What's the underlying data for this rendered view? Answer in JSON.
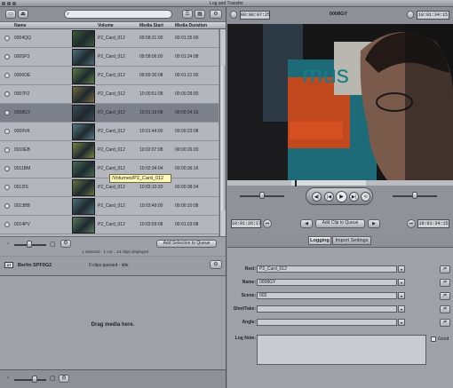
{
  "window": {
    "title": "Log and Transfer"
  },
  "browser": {
    "search_placeholder": "",
    "columns": {
      "name": "Name",
      "volume": "Volume",
      "media_start": "Media Start",
      "media_duration": "Media Duration"
    },
    "clips": [
      {
        "name": "0004QQ",
        "volume": "P2_Card_012",
        "start": "09:58:31:00",
        "duration": "00:01:35:00",
        "selected": false,
        "thumb": "#3d5a3a"
      },
      {
        "name": "0005P3",
        "volume": "P2_Card_012",
        "start": "09:58:06:00",
        "duration": "00:01:24:08",
        "selected": false,
        "thumb": "#4d6f7a"
      },
      {
        "name": "0006OE",
        "volume": "P2_Card_012",
        "start": "09:59:30:08",
        "duration": "00:01:21:00",
        "selected": false,
        "thumb": "#5e7b45"
      },
      {
        "name": "0007P2",
        "volume": "P2_Card_012",
        "start": "10:00:51:08",
        "duration": "00:00:28:00",
        "selected": false,
        "thumb": "#7a6a3e"
      },
      {
        "name": "0008GY",
        "volume": "P2_Card_012",
        "start": "10:01:19:08",
        "duration": "00:00:24:16",
        "selected": true,
        "thumb": "#3f4a55"
      },
      {
        "name": "0009VK",
        "volume": "P2_Card_012",
        "start": "10:01:44:00",
        "duration": "00:00:23:08",
        "selected": false,
        "thumb": "#557a86"
      },
      {
        "name": "0010EB",
        "volume": "P2_Card_012",
        "start": "10:02:07:08",
        "duration": "00:00:26:20",
        "selected": false,
        "thumb": "#7a8040"
      },
      {
        "name": "0011BM",
        "volume": "P2_Card_012",
        "start": "10:02:34:04",
        "duration": "00:00:36:16",
        "selected": false,
        "thumb": "#4a6a50"
      },
      {
        "name": "0012IS",
        "volume": "P2_Card_012",
        "start": "10:03:10:20",
        "duration": "00:00:38:04",
        "selected": false,
        "thumb": "#6a7040"
      },
      {
        "name": "0013BB",
        "volume": "P2_Card_012",
        "start": "10:03:49:00",
        "duration": "00:00:10:08",
        "selected": false,
        "thumb": "#4e6e78"
      },
      {
        "name": "0014PV",
        "volume": "P2_Card_012",
        "start": "10:03:59:08",
        "duration": "00:01:03:08",
        "selected": false,
        "thumb": "#5a7a5a"
      }
    ],
    "tooltip": "/Volumes/P2_Card_012",
    "status_text": "1 selected · 1 not .. 14 clips displayed",
    "add_selection_button": "Add Selection to Queue"
  },
  "queue": {
    "device_badge": "AT",
    "device_name": "Berlin SPF0G2",
    "queue_status": "0 clips queued - idle",
    "drop_message": "Drag media here."
  },
  "viewer": {
    "timecode_duration": "00:00:07:25",
    "clip_name": "0008GY",
    "timecode_current": "10:01:34:15",
    "mark_in": "10:01:26:17",
    "mark_out": "10:01:34:15",
    "add_clip_button": "Add Clip to Queue",
    "image_text": "mus"
  },
  "tabs": [
    {
      "label": "Logging",
      "active": true
    },
    {
      "label": "Import Settings",
      "active": false
    }
  ],
  "logging": {
    "reel_label": "Reel:",
    "reel_value": "P2_Card_012",
    "name_label": "Name:",
    "name_value": "0008GY",
    "scene_label": "Scene:",
    "scene_value": "002",
    "shot_label": "Shot/Take:",
    "shot_value": "",
    "angle_label": "Angle:",
    "angle_value": "",
    "lognote_label": "Log Note:",
    "good_label": "Good"
  }
}
